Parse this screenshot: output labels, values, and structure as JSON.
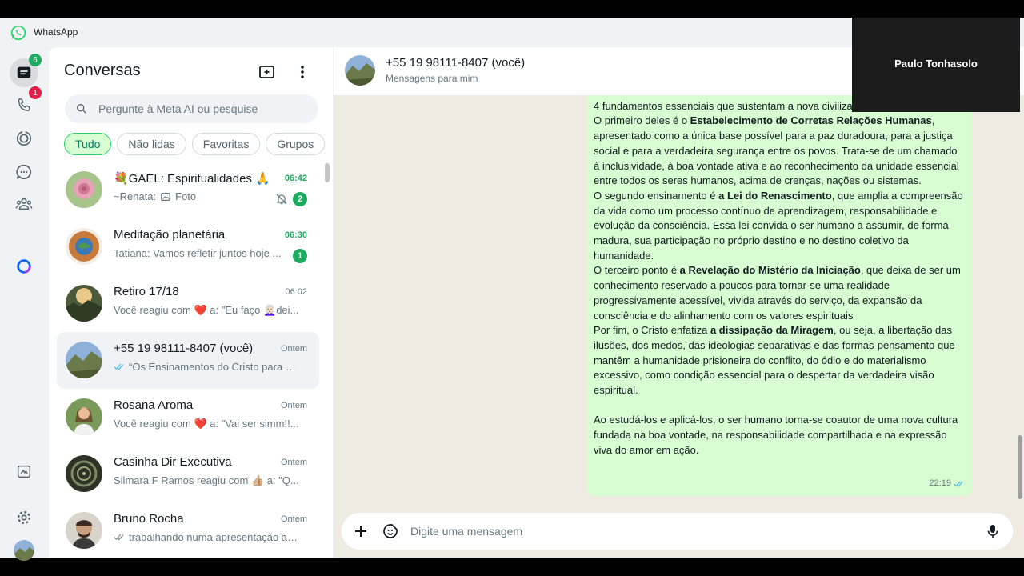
{
  "app": {
    "name": "WhatsApp"
  },
  "rail": {
    "chats_badge": "6",
    "calls_badge": "1"
  },
  "sidebar": {
    "title": "Conversas",
    "search_placeholder": "Pergunte à Meta AI ou pesquise",
    "filters": [
      "Tudo",
      "Não lidas",
      "Favoritas",
      "Grupos"
    ],
    "chats": [
      {
        "name": "💐GAEL: Espiritualidades 🙏",
        "time": "06:42",
        "sender": "~Renata:",
        "preview": "Foto",
        "unread": "2",
        "muted": true
      },
      {
        "name": "Meditação planetária",
        "time": "06:30",
        "preview": "Tatiana: Vamos refletir juntos hoje ...",
        "unread": "1"
      },
      {
        "name": "Retiro 17/18",
        "time": "06:02",
        "preview": "Você reagiu com ❤️ a: \"Eu faço 👩🏻‍🦳dei..."
      },
      {
        "name": "+55 19 98111-8407 (você)",
        "time": "Ontem",
        "preview": "“Os Ensinamentos do Cristo para a ..."
      },
      {
        "name": "Rosana Aroma",
        "time": "Ontem",
        "preview": "Você reagiu com ❤️ a: \"Vai ser simm!!..."
      },
      {
        "name": "Casinha Dir Executiva",
        "time": "Ontem",
        "preview": "Silmara F Ramos reagiu com 👍🏼 a: \"Q..."
      },
      {
        "name": "Bruno Rocha",
        "time": "Ontem",
        "preview": "trabalhando numa apresentação ag..."
      }
    ]
  },
  "chat": {
    "name": "+55 19 98111-8407 (você)",
    "subtitle": "Mensagens para mim",
    "message": {
      "p0": "4 fundamentos essenciais que sustentam a nova civilização em gestação.",
      "p1a": "O primeiro deles é o ",
      "p1b": "Estabelecimento de Corretas Relações Humanas",
      "p1c": ", apresentado como a única base possível para a paz duradoura, para a justiça social e para a verdadeira segurança entre os povos. Trata-se de um chamado à inclusividade, à boa vontade ativa e ao reconhecimento da unidade essencial entre todos os seres humanos, acima de crenças, nações ou sistemas.",
      "p2a": "O segundo ensinamento é ",
      "p2b": "a Lei do Renascimento",
      "p2c": ", que amplia a compreensão da vida como um processo contínuo de aprendizagem, responsabilidade e evolução da consciência. Essa lei convida o ser humano a assumir, de forma madura, sua participação no próprio destino e no destino coletivo da humanidade.",
      "p3a": "O terceiro ponto é ",
      "p3b": "a Revelação do Mistério da Iniciação",
      "p3c": ", que deixa de ser um conhecimento reservado a poucos para tornar-se uma realidade progressivamente acessível, vivida através do serviço, da expansão da consciência e do alinhamento com os valores espirituais",
      "p4a": "Por fim, o Cristo enfatiza ",
      "p4b": "a dissipação da Miragem",
      "p4c": ", ou seja, a libertação das ilusões, dos medos, das ideologias separativas e das formas-pensamento que mantêm a humanidade prisioneira do conflito, do ódio e do materialismo excessivo, como condição essencial para o despertar da verdadeira visão espiritual.",
      "p5": "Ao estudá-los e aplicá-los, o ser humano torna-se coautor de uma nova cultura fundada na boa vontade, na responsabilidade compartilhada e na expressão viva do amor em ação.",
      "time": "22:19"
    },
    "composer_placeholder": "Digite uma mensagem"
  },
  "video_overlay": {
    "name": "Paulo Tonhasolo"
  },
  "colors": {
    "accent": "#25d366",
    "unread": "#1daa61",
    "bubble": "#d9fdd3",
    "badge_red": "#e11d48",
    "background": "#efeae2"
  }
}
